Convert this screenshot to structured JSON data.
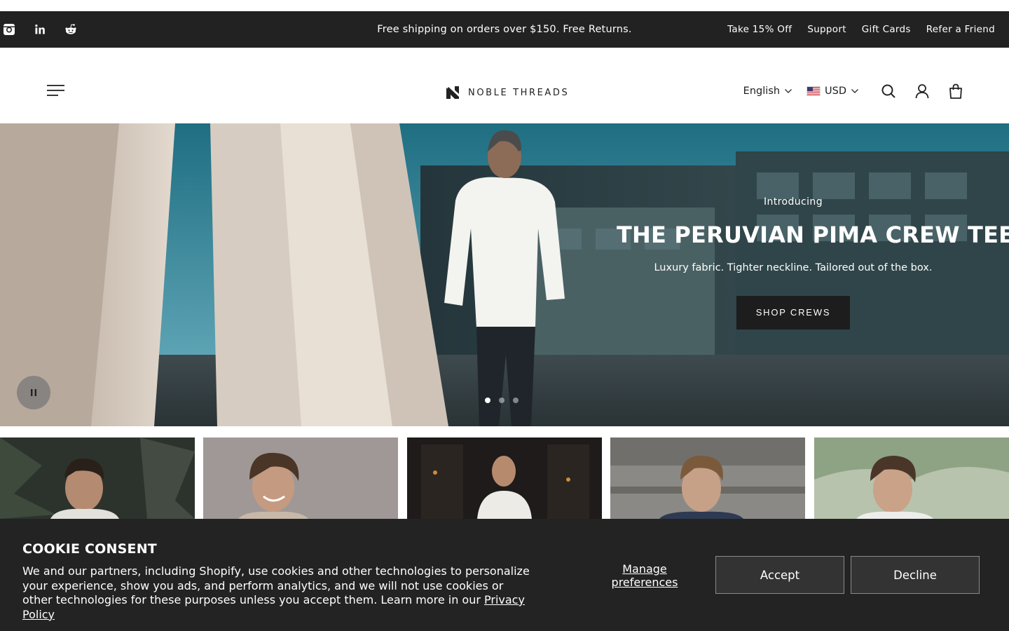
{
  "announcement": {
    "social": [
      "instagram-icon",
      "linkedin-icon",
      "reddit-icon"
    ],
    "message": "Free shipping on orders over $150. Free Returns.",
    "links": [
      "Take 15% Off",
      "Support",
      "Gift Cards",
      "Refer a Friend"
    ]
  },
  "header": {
    "logo_text": "NOBLE THREADS",
    "language": "English",
    "currency": "USD",
    "icons": [
      "menu-icon",
      "search-icon",
      "account-icon",
      "cart-icon"
    ]
  },
  "hero": {
    "eyebrow": "Introducing",
    "headline": "THE PERUVIAN PIMA CREW TEE",
    "subline": "Luxury fabric. Tighter neckline. Tailored out of the box.",
    "cta": "SHOP CREWS",
    "slide_count": 3,
    "active_slide": 1
  },
  "cookie": {
    "title": "COOKIE CONSENT",
    "body": "We and our partners, including Shopify, use cookies and other technologies to personalize your experience, show you ads, and perform analytics, and we will not use cookies or other technologies for these purposes unless you accept them. Learn more in our ",
    "policy_link": "Privacy Policy",
    "manage": "Manage preferences",
    "accept": "Accept",
    "decline": "Decline"
  },
  "colors": {
    "bar": "#222222",
    "banner": "#232323",
    "cta": "#1d1d1d"
  }
}
